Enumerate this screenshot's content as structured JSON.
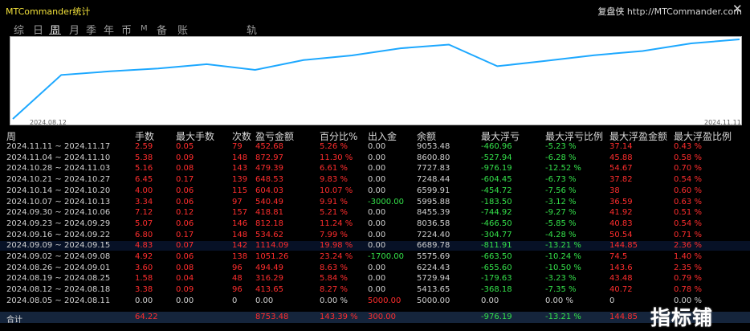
{
  "header": {
    "app_title": "MTCommander统计",
    "brand_name": "复盘侠",
    "site": "http://MTCommander.com",
    "close_label": "✕"
  },
  "tabs": [
    "综",
    "日",
    "周",
    "月",
    "季",
    "年",
    "币",
    "M",
    "备",
    "账户",
    "轨迹"
  ],
  "active_tab": "周",
  "chart": {
    "type": "line",
    "start_label": "2024.08.12",
    "end_label": "2024.11.11",
    "line_color": "#1da8ff",
    "background": "#ffffff",
    "series": [
      0,
      5000,
      5413.65,
      5729.94,
      6224.43,
      5575.69,
      6689.78,
      7224.4,
      8036.58,
      8455.39,
      5995.88,
      6599.91,
      7248.44,
      7727.83,
      8600.8,
      9053.48
    ]
  },
  "table": {
    "columns": [
      "周",
      "手数",
      "最大手数",
      "次数",
      "盈亏金额",
      "百分比%",
      "出入金",
      "余额",
      "最大浮亏",
      "最大浮亏比例",
      "最大浮盈金额",
      "最大浮盈比例"
    ],
    "rows": [
      [
        "2024.11.11 ~ 2024.11.17",
        "2.59",
        "0.05",
        "79",
        "452.68",
        "5.26 %",
        "0.00",
        "9053.48",
        "-460.96",
        "-5.23 %",
        "37.14",
        "0.43 %"
      ],
      [
        "2024.11.04 ~ 2024.11.10",
        "5.38",
        "0.09",
        "148",
        "872.97",
        "11.30 %",
        "0.00",
        "8600.80",
        "-527.94",
        "-6.28 %",
        "45.88",
        "0.58 %"
      ],
      [
        "2024.10.28 ~ 2024.11.03",
        "5.16",
        "0.08",
        "143",
        "479.39",
        "6.61 %",
        "0.00",
        "7727.83",
        "-976.19",
        "-12.52 %",
        "54.67",
        "0.70 %"
      ],
      [
        "2024.10.21 ~ 2024.10.27",
        "6.45",
        "0.17",
        "139",
        "648.53",
        "9.83 %",
        "0.00",
        "7248.44",
        "-604.45",
        "-6.73 %",
        "37.82",
        "0.54 %"
      ],
      [
        "2024.10.14 ~ 2024.10.20",
        "4.00",
        "0.06",
        "115",
        "604.03",
        "10.07 %",
        "0.00",
        "6599.91",
        "-454.72",
        "-7.56 %",
        "38",
        "0.60 %"
      ],
      [
        "2024.10.07 ~ 2024.10.13",
        "3.34",
        "0.06",
        "97",
        "540.49",
        "9.91 %",
        "-3000.00",
        "5995.88",
        "-183.50",
        "-3.12 %",
        "36.59",
        "0.63 %"
      ],
      [
        "2024.09.30 ~ 2024.10.06",
        "7.12",
        "0.12",
        "157",
        "418.81",
        "5.21 %",
        "0.00",
        "8455.39",
        "-744.92",
        "-9.27 %",
        "41.92",
        "0.51 %"
      ],
      [
        "2024.09.23 ~ 2024.09.29",
        "5.07",
        "0.06",
        "146",
        "812.18",
        "11.24 %",
        "0.00",
        "8036.58",
        "-466.50",
        "-5.85 %",
        "40.83",
        "0.54 %"
      ],
      [
        "2024.09.16 ~ 2024.09.22",
        "6.80",
        "0.17",
        "148",
        "534.62",
        "7.99 %",
        "0.00",
        "7224.40",
        "-304.77",
        "-4.28 %",
        "50.54",
        "0.71 %"
      ],
      [
        "2024.09.09 ~ 2024.09.15",
        "4.83",
        "0.07",
        "142",
        "1114.09",
        "19.98 %",
        "0.00",
        "6689.78",
        "-811.91",
        "-13.21 %",
        "144.85",
        "2.36 %"
      ],
      [
        "2024.09.02 ~ 2024.09.08",
        "4.92",
        "0.06",
        "138",
        "1051.26",
        "23.24 %",
        "-1700.00",
        "5575.69",
        "-663.50",
        "-10.24 %",
        "74.5",
        "1.40 %"
      ],
      [
        "2024.08.26 ~ 2024.09.01",
        "3.60",
        "0.08",
        "96",
        "494.49",
        "8.63 %",
        "0.00",
        "6224.43",
        "-655.60",
        "-10.50 %",
        "143.6",
        "2.35 %"
      ],
      [
        "2024.08.19 ~ 2024.08.25",
        "1.58",
        "0.04",
        "48",
        "316.29",
        "5.84 %",
        "0.00",
        "5729.94",
        "-179.63",
        "-3.23 %",
        "43.48",
        "0.79 %"
      ],
      [
        "2024.08.12 ~ 2024.08.18",
        "3.38",
        "0.09",
        "96",
        "413.65",
        "8.27 %",
        "0.00",
        "5413.65",
        "-368.18",
        "-7.35 %",
        "40.72",
        "0.78 %"
      ],
      [
        "2024.08.05 ~ 2024.08.11",
        "0.00",
        "0.00",
        "0",
        "0.00",
        "0.00 %",
        "5000.00",
        "5000.00",
        "0.00",
        "0.00 %",
        "0",
        "0.00 %"
      ]
    ],
    "total": {
      "label": "合计",
      "lots": "64.22",
      "pnl": "8753.48",
      "pct": "143.39 %",
      "cash": "300.00",
      "max_float_loss": "-976.19",
      "max_float_loss_pct": "-13.21 %",
      "max_float_profit": "144.85"
    }
  },
  "watermark": "指标铺"
}
